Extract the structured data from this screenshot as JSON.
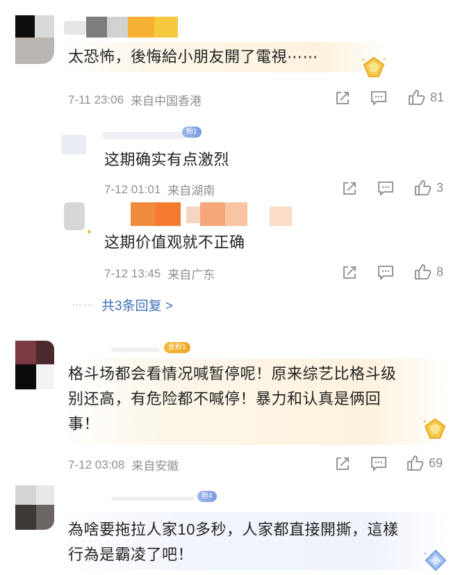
{
  "comments": [
    {
      "text": "太恐怖，後悔給小朋友開了電視⋯⋯",
      "time": "7-11 23:06",
      "location": "来自中国香港",
      "likes": "81"
    },
    {
      "text": "这期确实有点激烈",
      "time": "7-12 01:01",
      "location": "来自湖南",
      "likes": "3",
      "badge": "粉1"
    },
    {
      "text": "这期价值观就不正确",
      "time": "7-12 13:45",
      "location": "来自广东",
      "likes": "8"
    },
    {
      "text_lines": [
        "格斗场都会看情况喊暂停呢！原来综艺比格斗级",
        "别还高，有危险都不喊停！暴力和认真是俩回",
        "事！"
      ],
      "time": "7-12 03:08",
      "location": "来自安徽",
      "likes": "69",
      "badge": "金粉1"
    },
    {
      "text_lines": [
        "為啥要拖拉人家10多秒，人家都直接開撕，這樣",
        "行為是霸凌了吧！"
      ],
      "badge": "粉4"
    }
  ],
  "replies_link": "共3条回复 >",
  "replies_dots": "⋯⋯",
  "icons": [
    "share-icon",
    "comment-icon",
    "like-icon",
    "gold-diamond-icon",
    "blue-diamond-icon"
  ],
  "colors": {
    "link": "#3a6fb7",
    "meta": "#8f8f8f",
    "gold_bubble": "#fdf2de",
    "blue_bubble": "#eef3fc"
  }
}
